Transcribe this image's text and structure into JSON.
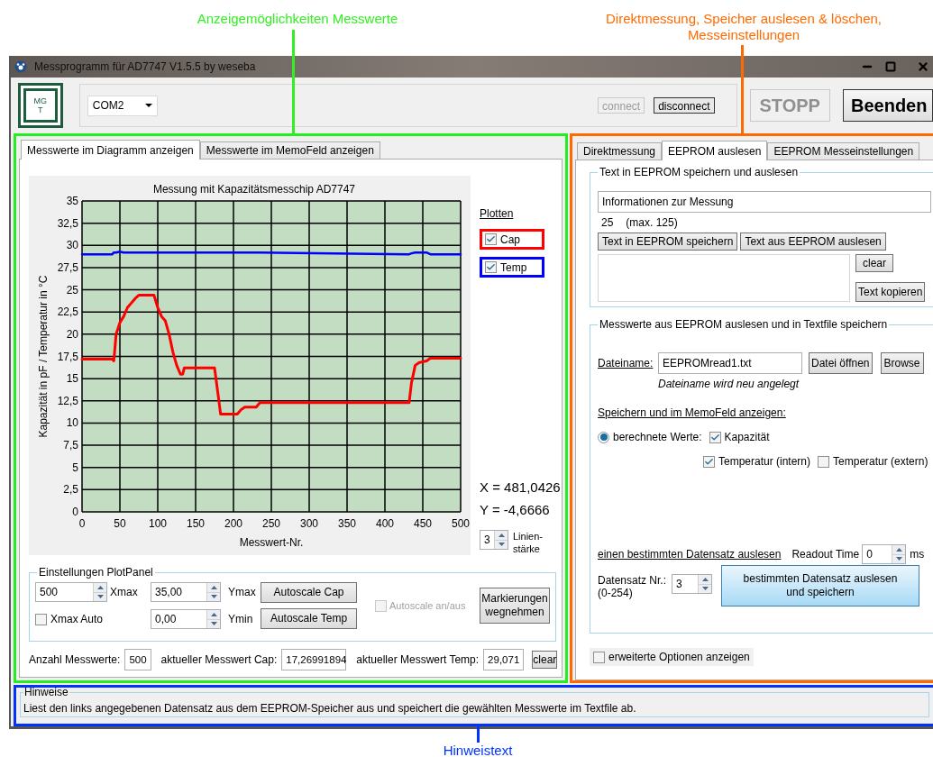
{
  "callouts": [
    {
      "lines": [
        "Anzeigemöglichkeiten Messwerte"
      ],
      "color": "#33ee22"
    },
    {
      "lines": [
        "Direktmessung, Speicher auslesen & löschen,",
        "Messeinstellungen"
      ],
      "color": "#ff6a00"
    },
    {
      "lines": [
        "Hinweistext"
      ],
      "color": "#0033ff"
    }
  ],
  "window": {
    "title": "Messprogramm für AD7747 V1.5.5 by weseba"
  },
  "toolbar": {
    "logo_lines": [
      "MG",
      "T"
    ],
    "port": "COM2",
    "buttons": [
      {
        "kind": "small",
        "label": "connect",
        "disabled": true
      },
      {
        "kind": "small",
        "label": "disconnect",
        "disabled": false
      },
      {
        "kind": "large",
        "label": "STOPP",
        "disabled": true
      },
      {
        "kind": "large",
        "label": "Beenden",
        "disabled": false
      }
    ]
  },
  "left_panel": {
    "tabs": [
      {
        "label": "Messwerte im Diagramm anzeigen",
        "selected": true
      },
      {
        "label": "Messwerte im MemoFeld anzeigen",
        "selected": false
      }
    ],
    "chart_data": {
      "type": "line",
      "title": "Messung mit Kapazitätsmesschip AD7747",
      "xlabel": "Messwert-Nr.",
      "ylabel": "Kapazität in pF / Temperatur in °C",
      "x": [
        0,
        40,
        42,
        45,
        50,
        55,
        60,
        65,
        70,
        75,
        95,
        100,
        105,
        110,
        115,
        120,
        125,
        130,
        133,
        135,
        175,
        180,
        183,
        205,
        210,
        215,
        230,
        235,
        432,
        435,
        440,
        445,
        455,
        460,
        500
      ],
      "series": [
        {
          "name": "Cap",
          "color": "#ff0000",
          "values": [
            17.2,
            17.2,
            17.0,
            20.0,
            21.3,
            22.0,
            23.0,
            23.5,
            24.0,
            24.4,
            24.4,
            23.0,
            22.0,
            21.5,
            20.0,
            18.0,
            16.5,
            15.5,
            15.5,
            16.2,
            16.2,
            13.0,
            11.0,
            11.0,
            11.5,
            11.8,
            11.8,
            12.3,
            12.3,
            14.5,
            16.5,
            16.8,
            17.0,
            17.3,
            17.3
          ]
        },
        {
          "name": "Temp",
          "color": "#0000ff",
          "values": [
            29.0,
            29.0,
            29.2,
            29.2,
            29.3,
            29.2,
            29.2,
            29.2,
            29.2,
            29.2,
            29.2,
            29.2,
            29.2,
            29.2,
            29.2,
            29.2,
            29.2,
            29.2,
            29.2,
            29.2,
            29.2,
            29.2,
            29.2,
            29.2,
            29.2,
            29.2,
            29.2,
            29.2,
            29.0,
            29.1,
            29.2,
            29.2,
            29.2,
            29.0,
            29.0
          ]
        }
      ],
      "xlim": [
        0,
        500
      ],
      "ylim": [
        0,
        35
      ],
      "grid": true,
      "xticks": [
        0,
        50,
        100,
        150,
        200,
        250,
        300,
        350,
        400,
        450,
        500
      ],
      "yticks": [
        0,
        {
          "value": 2.5,
          "label": "2,5"
        },
        5,
        {
          "value": 7.5,
          "label": "7,5"
        },
        10,
        {
          "value": 12.5,
          "label": "12,5"
        },
        15,
        {
          "value": 17.5,
          "label": "17,5"
        },
        20,
        {
          "value": 22.5,
          "label": "22,5"
        },
        25,
        {
          "value": 27.5,
          "label": "27,5"
        },
        30,
        {
          "value": 32.5,
          "label": "32,5"
        },
        35
      ]
    },
    "plot_toggles": {
      "title": "Plotten",
      "items": [
        {
          "checked": true
        },
        {
          "checked": true
        }
      ]
    },
    "cursor": [
      "X = 481,0426",
      "Y = -4,6666"
    ],
    "line_width": {
      "value": "3",
      "label_lines": [
        "Linien-",
        "stärke"
      ]
    },
    "plot_settings": {
      "title": "Einstellungen PlotPanel",
      "xmax": {
        "value": "500",
        "label": "Xmax"
      },
      "xmax_auto": {
        "label": "Xmax Auto",
        "checked": false
      },
      "ymax": {
        "value": "35,00",
        "label": "Ymax"
      },
      "ymin": {
        "value": "0,00",
        "label": "Ymin"
      },
      "autoscale_cap": "Autoscale Cap",
      "autoscale_temp": "Autoscale Temp",
      "autoscale_toggle": {
        "label": "Autoscale an/aus",
        "checked": false,
        "disabled": true
      },
      "clear_marks": "Markierungen wegnehmen"
    },
    "readings": [
      {
        "label": "Anzahl Messwerte:",
        "value": "500"
      },
      {
        "label": "aktueller Messwert Cap:",
        "value": "17,26991894"
      },
      {
        "label": "aktueller Messwert Temp:",
        "value": "29,071"
      }
    ],
    "clear_button": "clear"
  },
  "right_panel": {
    "tabs": [
      {
        "label": "Direktmessung",
        "selected": false
      },
      {
        "label": "EEPROM auslesen",
        "selected": true
      },
      {
        "label": "EEPROM Messeinstellungen",
        "selected": false
      }
    ],
    "text_group": {
      "title": "Text in EEPROM speichern und auslesen",
      "value": "Informationen zur Messung",
      "count": "25",
      "max": "(max. 125)",
      "buttons": [
        "Text in EEPROM speichern",
        "Text aus EEPROM auslesen"
      ],
      "clear": "clear",
      "copy": "Text kopieren"
    },
    "file_group": {
      "title": "Messwerte aus EEPROM auslesen und in Textfile speichern",
      "file_label": "Dateiname:",
      "file_value": "EEPROMread1.txt",
      "open": "Datei öffnen",
      "browse": "Browse",
      "file_note": "Dateiname wird neu angelegt",
      "save_heading": "Speichern und im MemoFeld anzeigen:",
      "radio": {
        "label": "berechnete Werte:",
        "selected": true
      },
      "options": [
        {
          "label": "Kapazität",
          "checked": true
        },
        {
          "label": "Temperatur (intern)",
          "checked": true
        },
        {
          "label": "Temperatur (extern)",
          "checked": false
        }
      ],
      "record_heading": "einen bestimmten Datensatz auslesen",
      "readout_label": "Readout Time",
      "readout_value": "0",
      "readout_unit": "ms",
      "record_label": "Datensatz Nr.:",
      "record_range": "(0-254)",
      "record_value": "3",
      "record_button_lines": [
        "bestimmten Datensatz auslesen",
        "und speichern"
      ]
    },
    "extended_option": {
      "label": "erweiterte Optionen anzeigen",
      "checked": false
    }
  },
  "hints": {
    "title": "Hinweise",
    "text": "Liest den links angegebenen Datensatz aus dem EEPROM-Speicher aus und speichert die gewählten Messwerte im Textfile ab."
  }
}
